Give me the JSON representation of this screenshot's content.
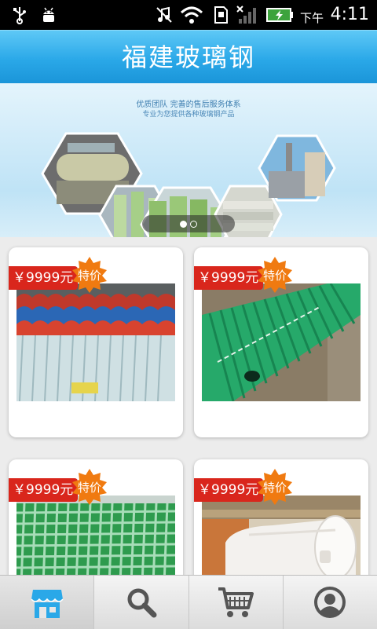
{
  "status_bar": {
    "ampm": "下午",
    "time": "4:11",
    "icons": [
      "usb-icon",
      "android-debug-icon",
      "music-off-icon",
      "wifi-icon",
      "sd-card-icon",
      "signal-icon",
      "battery-charging-icon"
    ]
  },
  "header": {
    "title": "福建玻璃钢"
  },
  "banner": {
    "slogan_line1": "优质团队 完善的售后服务体系",
    "slogan_line2": "专业为您提供各种玻璃钢产品",
    "slide_count": 2,
    "active_slide": 1
  },
  "products": [
    {
      "price": "￥9999元",
      "badge": "特价",
      "image": "corrugated-roofing-sheets"
    },
    {
      "price": "￥9999元",
      "badge": "特价",
      "image": "green-ribbed-pipe"
    },
    {
      "price": "￥9999元",
      "badge": "特价",
      "image": "green-grating"
    },
    {
      "price": "￥9999元",
      "badge": "特价",
      "image": "white-storage-tank"
    }
  ],
  "bottom_nav": [
    {
      "name": "shop",
      "icon": "store-icon",
      "active": true
    },
    {
      "name": "search",
      "icon": "search-icon",
      "active": false
    },
    {
      "name": "cart",
      "icon": "cart-icon",
      "active": false
    },
    {
      "name": "account",
      "icon": "user-icon",
      "active": false
    }
  ],
  "colors": {
    "header_blue": "#2aa8e8",
    "price_red": "#d9261c",
    "badge_orange": "#f07a10"
  }
}
